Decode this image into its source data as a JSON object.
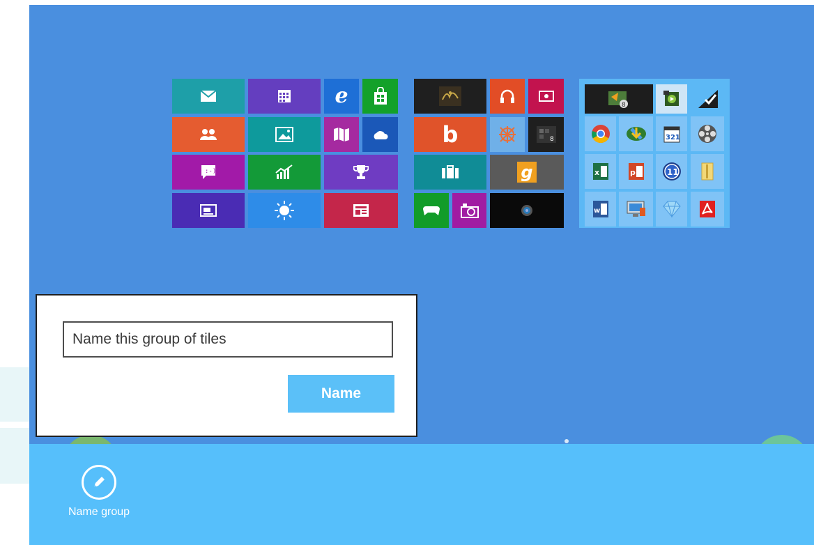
{
  "dialog": {
    "input_placeholder": "Name this group of tiles",
    "input_value": "",
    "button_label": "Name"
  },
  "appbar": {
    "commands": [
      {
        "label": "Name group",
        "icon": "pencil-icon"
      }
    ]
  },
  "groups": [
    {
      "name": "group-1",
      "tiles": [
        {
          "name": "mail-tile",
          "icon": "mail-icon",
          "color": "#1e9fa8"
        },
        {
          "name": "calendar-tile",
          "icon": "calendar-icon",
          "color": "#643ebf"
        },
        {
          "name": "internet-explorer-tile",
          "icon": "internet-explorer-icon",
          "color": "#1e6fd6"
        },
        {
          "name": "store-tile",
          "icon": "store-icon",
          "color": "#13a12a"
        },
        {
          "name": "people-tile",
          "icon": "people-icon",
          "color": "#e55c30"
        },
        {
          "name": "photos-tile",
          "icon": "photos-icon",
          "color": "#0e9a9c"
        },
        {
          "name": "maps-tile",
          "icon": "maps-icon",
          "color": "#a52aa0"
        },
        {
          "name": "skydrive-tile",
          "icon": "cloud-icon",
          "color": "#1b58b8"
        },
        {
          "name": "messaging-tile",
          "icon": "messaging-icon",
          "color": "#a21aa8"
        },
        {
          "name": "finance-tile",
          "icon": "finance-icon",
          "color": "#139a38"
        },
        {
          "name": "games-tile",
          "icon": "trophy-icon",
          "color": "#6f3cc2"
        },
        {
          "name": "desktop-tile",
          "icon": "desktop-icon",
          "color": "#4a2cb4"
        },
        {
          "name": "weather-tile",
          "icon": "sun-icon",
          "color": "#2e8ce8"
        },
        {
          "name": "news-tile",
          "icon": "news-icon",
          "color": "#c4264a"
        }
      ]
    },
    {
      "name": "group-2",
      "tiles": [
        {
          "name": "quran-tile",
          "icon": "calligraphy-icon",
          "color": "#1f1f1f"
        },
        {
          "name": "music-tile",
          "icon": "headphones-icon",
          "color": "#e24d26"
        },
        {
          "name": "video-tile",
          "icon": "video-icon",
          "color": "#c2134e"
        },
        {
          "name": "bing-tile",
          "icon": "bing-icon",
          "color": "#e0532a"
        },
        {
          "name": "zune-tile",
          "icon": "zune-icon",
          "color": "#6fb0e8"
        },
        {
          "name": "metro-app-tile",
          "icon": "app-icon",
          "color": "#1f1f1f"
        },
        {
          "name": "travel-tile",
          "icon": "suitcase-icon",
          "color": "#108c96"
        },
        {
          "name": "gmail-style-tile",
          "icon": "g-icon",
          "color": "#5a5a5a"
        },
        {
          "name": "xbox-games-tile",
          "icon": "gamepad-icon",
          "color": "#129c29"
        },
        {
          "name": "camera-tile",
          "icon": "camera-icon",
          "color": "#a01ca2"
        },
        {
          "name": "camera-app-tile",
          "icon": "lens-icon",
          "color": "#0a0a0a"
        }
      ]
    },
    {
      "name": "group-3",
      "tiles": [
        {
          "name": "app-tile-1",
          "icon": "app-icon",
          "color": "#1d1d1d"
        },
        {
          "name": "app-tile-2",
          "icon": "app-icon",
          "color": "#cfe5f6"
        },
        {
          "name": "selected-check",
          "icon": "check-icon",
          "color": "#5cb8f5"
        },
        {
          "name": "chrome-tile",
          "icon": "chrome-icon",
          "color": "#80c3f6"
        },
        {
          "name": "idm-tile",
          "icon": "download-icon",
          "color": "#80c3f6"
        },
        {
          "name": "media-player-tile",
          "icon": "media-icon",
          "color": "#80c3f6"
        },
        {
          "name": "film-tile",
          "icon": "film-icon",
          "color": "#80c3f6"
        },
        {
          "name": "excel-tile",
          "icon": "excel-icon",
          "color": "#80c3f6"
        },
        {
          "name": "powerpoint-tile",
          "icon": "powerpoint-icon",
          "color": "#80c3f6"
        },
        {
          "name": "app-11-tile",
          "icon": "eleven-icon",
          "color": "#80c3f6"
        },
        {
          "name": "folder-tile",
          "icon": "folder-icon",
          "color": "#80c3f6"
        },
        {
          "name": "word-tile",
          "icon": "word-icon",
          "color": "#80c3f6"
        },
        {
          "name": "computer-tile",
          "icon": "computer-icon",
          "color": "#80c3f6"
        },
        {
          "name": "gem-tile",
          "icon": "gem-icon",
          "color": "#80c3f6"
        },
        {
          "name": "pdf-tile",
          "icon": "pdf-icon",
          "color": "#80c3f6"
        }
      ]
    }
  ]
}
